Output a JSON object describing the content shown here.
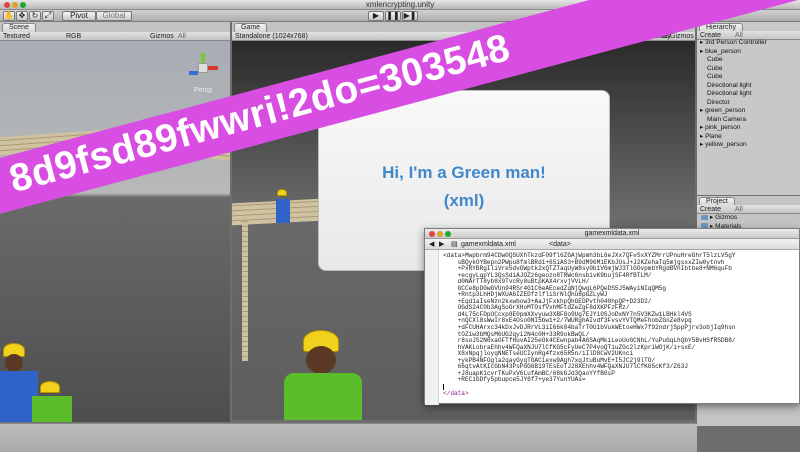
{
  "window": {
    "title": "xmlencrypting.unity"
  },
  "toolbar": {
    "pivot_label": "Pivot",
    "global_label": "Global"
  },
  "scene": {
    "tab": "Scene",
    "shading": "Textured",
    "render_mode": "RGB",
    "gizmos": "Gizmos",
    "search": "All",
    "gizmo_label": "Persp"
  },
  "game": {
    "tab": "Game",
    "resolution": "Standalone (1024x768)",
    "maximize": "Maximize on Play",
    "stats": "Stats",
    "gizmos": "Gizmos",
    "message_line1": "Hi, I'm a Green man!",
    "message_line2": "(xml)"
  },
  "hierarchy": {
    "tab": "Hierarchy",
    "create": "Create",
    "search": "All",
    "items": [
      "▸ 3rd Person Controller",
      "▸ blue_person",
      "Cube",
      "Cube",
      "Cube",
      "Directional light",
      "Directional light",
      "Director",
      "▸ green_person",
      "Main Camera",
      "▸ pink_person",
      "▸ Plane",
      "▸ yellow_person"
    ]
  },
  "project": {
    "tab": "Project",
    "create": "Create",
    "search": "All",
    "items": [
      "▸ Gizmos",
      "▸ Materials"
    ]
  },
  "xml_window": {
    "title": "gamexmldata.xml",
    "file": "gamexmldata.xml",
    "element": "<data>",
    "lines": [
      "<data>Mwpbrm94CDw0QSUXhTkzdF09fl6ZGAjWpmh3bL6eJXx7QFvSxXYZMrrUPnuHreGhrT5lzLV5gY",
      "    sBQykOYBepn2PWpu8fmlBRd1+65iAS3+B9dM96M1EKbJUsJ+J2KZehaTq5mjgsxxZIw0ytnvh",
      "    +PxRYBRgIliVre5dvGWptk2xQTZTaqUyW8sy0b1V6mjWJ3TlGOvpmbYRgdBVnIbtbe8+NM6quFb",
      "    +ecgyLqpYL3QsSdiAJOZz6geozo8TRWc6nsbivK9bujSF4RfBTLM/",
      "    d0NArTT8yb8x9TvcRy8uBtpKAX4rxvjVVLH/",
      "    GCCe8pD0wGVUn94RSr4G1C6eAEcedZqNjQwqL6PQeDS5J5WAyiNIqQM5g",
      "    +Rntp3LhHDjWXUA6IZEDfzlfliSrNlQhu8pGZLyWJ",
      "    +Eqd1aIseNzn2kxwbow3+AaJjFxkhpQhGEDPvth040hpQP+D23D2/",
      "    OGdS24C0b3AgSoGrXHoMTOsfVxhMFtdZeZgF8dXKPFzFRz/",
      "    d4L75cFDpOCcxp8E0pmXXvyuw3XBF8o9Ug7EJYi0SJoDxNY7n5V3KZw1LBHkl4VS",
      "    +nQCXl8sWwIr8xE4Oso0NI5bw1+2/7WURghAIvdf3FvsvYVTQMeFhobZGnZe8vpq",
      "    +dFCUHArxc34kDxJvDJRrVL3iI66k84baTrT0U1bVukWEtoeHWx7f92ndrjSppPjrv3objIq9hsn",
      "    tOZiw3bMQsM6UG2qyi2N4c0H+33R9okBwQL/",
      "    r8soJS2N6xaOFTfHuvAI25eOk4CEwnpab4A6SAqMkiLeoUoGCNhL/YuPuGqLhQbY5BvHSfRSDB8/",
      "    hVAKLobraEhhv4WFQaXNJU7lCfKG5cFyUeC7P4voQTiuZGc2lzKpriWOjK/i+sxE/",
      "    X8xNpqjloyqNNETseUCIynRg4fzx65R5n/iIlD8CwV2UKnci",
      "    +ykPB4NFOgla2qayGyqTGACiexw9Agh7xqJtuBuMvE+I5JC2j9lTO/",
      "    66qtvAtKIcGbN43PsPGG6B19TEsEoTJ28XEhhv4WFQaXNJU7lCfKG5cKf3/Z63J",
      "    +J8uapK1cvrTKuPxV6LufAmBC/68kGJd3QaoYYfB0sP",
      "    +RECiGDfy5pbupce5JY6f7+ye37YunYUAs="
    ],
    "close_tag": "</data>"
  },
  "overlay": {
    "text": "8d9fsd89fwwri!2do=303548"
  }
}
